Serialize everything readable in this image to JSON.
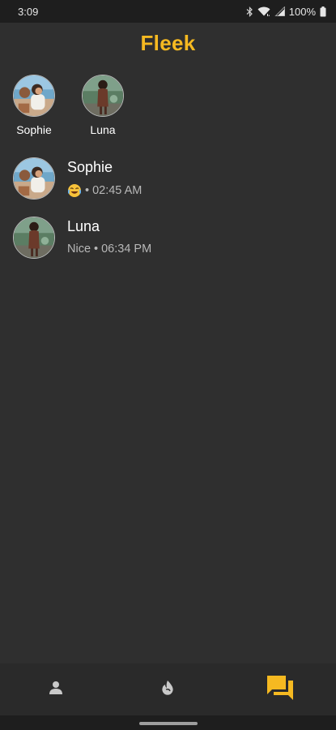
{
  "status_bar": {
    "time": "3:09",
    "battery": "100%",
    "icons": [
      "bluetooth-icon",
      "wifi-icon",
      "signal-icon",
      "battery-icon"
    ]
  },
  "app": {
    "title": "Fleek",
    "accent_color": "#f5b921"
  },
  "matches": [
    {
      "name": "Sophie",
      "avatar": "sophie-avatar"
    },
    {
      "name": "Luna",
      "avatar": "luna-avatar"
    }
  ],
  "conversations": [
    {
      "name": "Sophie",
      "last_message_emoji": "face-with-tears-of-joy",
      "separator": "•",
      "time": "02:45 AM"
    },
    {
      "name": "Luna",
      "last_message": "Nice",
      "separator": "•",
      "time": "06:34 PM"
    }
  ],
  "bottom_nav": {
    "items": [
      {
        "icon": "profile-icon",
        "active": false
      },
      {
        "icon": "flame-icon",
        "active": false
      },
      {
        "icon": "chat-icon",
        "active": true
      }
    ]
  }
}
